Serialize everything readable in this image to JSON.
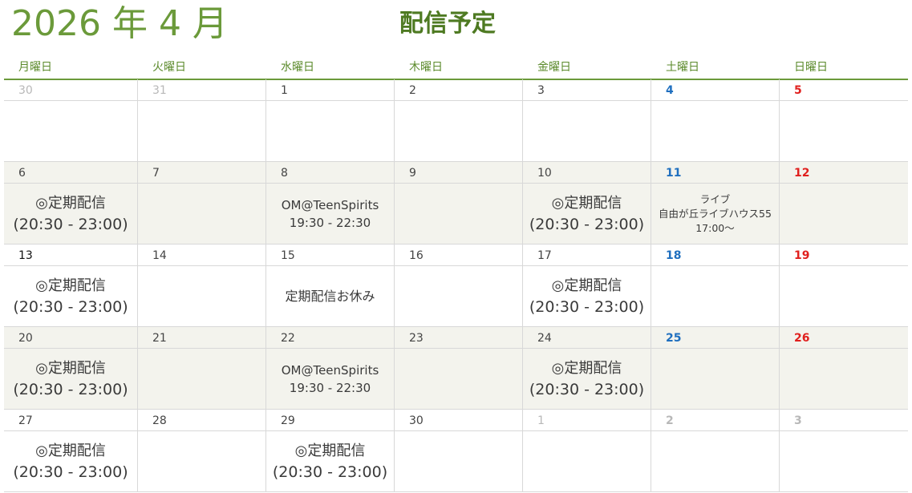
{
  "header": {
    "month_title": "2026 年 4 月",
    "schedule_title": "配信予定"
  },
  "weekdays": [
    "月曜日",
    "火曜日",
    "水曜日",
    "木曜日",
    "金曜日",
    "土曜日",
    "日曜日"
  ],
  "weeks": [
    {
      "days": [
        {
          "num": "30",
          "kind": "other"
        },
        {
          "num": "31",
          "kind": "other"
        },
        {
          "num": "1",
          "kind": "normal"
        },
        {
          "num": "2",
          "kind": "normal"
        },
        {
          "num": "3",
          "kind": "normal"
        },
        {
          "num": "4",
          "kind": "sat"
        },
        {
          "num": "5",
          "kind": "sun"
        }
      ],
      "events": []
    },
    {
      "days": [
        {
          "num": "6",
          "kind": "normal"
        },
        {
          "num": "7",
          "kind": "normal"
        },
        {
          "num": "8",
          "kind": "normal"
        },
        {
          "num": "9",
          "kind": "normal"
        },
        {
          "num": "10",
          "kind": "normal"
        },
        {
          "num": "11",
          "kind": "sat"
        },
        {
          "num": "12",
          "kind": "sun"
        }
      ],
      "events": [
        {
          "col": 0,
          "style": "big",
          "lines": [
            "◎定期配信",
            "(20:30 - 23:00)"
          ]
        },
        {
          "col": 2,
          "style": "mid",
          "lines": [
            "OM@TeenSpirits",
            "19:30 - 22:30"
          ]
        },
        {
          "col": 4,
          "style": "big",
          "lines": [
            "◎定期配信",
            "(20:30 - 23:00)"
          ]
        },
        {
          "col": 5,
          "style": "small",
          "lines": [
            "ライブ",
            "自由が丘ライブハウス55",
            "17:00～"
          ]
        }
      ]
    },
    {
      "days": [
        {
          "num": "13",
          "kind": "today"
        },
        {
          "num": "14",
          "kind": "normal"
        },
        {
          "num": "15",
          "kind": "normal"
        },
        {
          "num": "16",
          "kind": "normal"
        },
        {
          "num": "17",
          "kind": "normal"
        },
        {
          "num": "18",
          "kind": "sat"
        },
        {
          "num": "19",
          "kind": "sun"
        }
      ],
      "events": [
        {
          "col": 0,
          "style": "big",
          "lines": [
            "◎定期配信",
            "(20:30 - 23:00)"
          ]
        },
        {
          "col": 2,
          "style": "single",
          "lines": [
            "定期配信お休み"
          ]
        },
        {
          "col": 4,
          "style": "big",
          "lines": [
            "◎定期配信",
            "(20:30 - 23:00)"
          ]
        }
      ]
    },
    {
      "days": [
        {
          "num": "20",
          "kind": "normal"
        },
        {
          "num": "21",
          "kind": "normal"
        },
        {
          "num": "22",
          "kind": "normal"
        },
        {
          "num": "23",
          "kind": "normal"
        },
        {
          "num": "24",
          "kind": "normal"
        },
        {
          "num": "25",
          "kind": "sat"
        },
        {
          "num": "26",
          "kind": "sun"
        }
      ],
      "events": [
        {
          "col": 0,
          "style": "big",
          "lines": [
            "◎定期配信",
            "(20:30 - 23:00)"
          ]
        },
        {
          "col": 2,
          "style": "mid",
          "lines": [
            "OM@TeenSpirits",
            "19:30 - 22:30"
          ]
        },
        {
          "col": 4,
          "style": "big",
          "lines": [
            "◎定期配信",
            "(20:30 - 23:00)"
          ]
        }
      ]
    },
    {
      "days": [
        {
          "num": "27",
          "kind": "normal"
        },
        {
          "num": "28",
          "kind": "normal"
        },
        {
          "num": "29",
          "kind": "normal"
        },
        {
          "num": "30",
          "kind": "normal"
        },
        {
          "num": "1",
          "kind": "other"
        },
        {
          "num": "2",
          "kind": "sat other"
        },
        {
          "num": "3",
          "kind": "sun other"
        }
      ],
      "events": [
        {
          "col": 0,
          "style": "big",
          "lines": [
            "◎定期配信",
            "(20:30 - 23:00)"
          ]
        },
        {
          "col": 2,
          "style": "big",
          "lines": [
            "◎定期配信",
            "(20:30 - 23:00)"
          ]
        }
      ]
    }
  ]
}
